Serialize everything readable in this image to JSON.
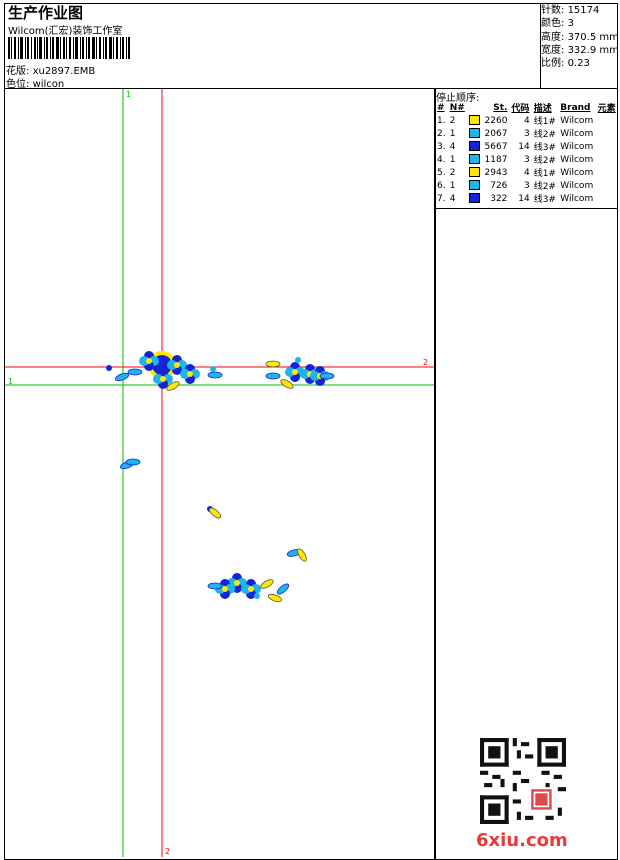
{
  "header": {
    "title": "生产作业图",
    "studio": "Wilcom(汇宏)装饰工作室",
    "pattern_label": "花版:",
    "pattern_value": "xu2897.EMB",
    "color_label": "色位:",
    "color_value": "wilcon"
  },
  "stats": [
    {
      "label": "针数:",
      "value": "15174"
    },
    {
      "label": "颜色:",
      "value": "3"
    },
    {
      "label": "高度:",
      "value": "370.5 mm"
    },
    {
      "label": "宽度:",
      "value": "332.9 mm"
    },
    {
      "label": "比例:",
      "value": "0.23"
    }
  ],
  "stops": {
    "title": "停止顺序:",
    "headers": [
      "#",
      "N#",
      "St.",
      "代码",
      "描述",
      "Brand",
      "元素"
    ],
    "rows": [
      {
        "idx": "1.",
        "n": "2",
        "color": "#ffe800",
        "st": "2260",
        "code": "4",
        "desc": "线1#",
        "brand": "Wilcom"
      },
      {
        "idx": "2.",
        "n": "1",
        "color": "#1eb4ee",
        "st": "2067",
        "code": "3",
        "desc": "线2#",
        "brand": "Wilcom"
      },
      {
        "idx": "3.",
        "n": "4",
        "color": "#1224d6",
        "st": "5667",
        "code": "14",
        "desc": "线3#",
        "brand": "Wilcom"
      },
      {
        "idx": "4.",
        "n": "1",
        "color": "#1eb4ee",
        "st": "1187",
        "code": "3",
        "desc": "线2#",
        "brand": "Wilcom"
      },
      {
        "idx": "5.",
        "n": "2",
        "color": "#ffe800",
        "st": "2943",
        "code": "4",
        "desc": "线1#",
        "brand": "Wilcom"
      },
      {
        "idx": "6.",
        "n": "1",
        "color": "#1eb4ee",
        "st": "726",
        "code": "3",
        "desc": "线2#",
        "brand": "Wilcom"
      },
      {
        "idx": "7.",
        "n": "4",
        "color": "#1224d6",
        "st": "322",
        "code": "14",
        "desc": "线3#",
        "brand": "Wilcom"
      }
    ]
  },
  "canvas": {
    "axis_x_label": "2",
    "axis_y_label": "1",
    "axis_top_label": "1",
    "axis_bottom_label": "2",
    "icons": [
      "flower-motif",
      "qr-code",
      "seal-stamp"
    ]
  },
  "colors": {
    "red_axis": "#ff0000",
    "green_axis": "#00c000",
    "yellow": "#ffe800",
    "cyan": "#1eb4ee",
    "blue": "#1224d6"
  },
  "watermark": "6xiu.com"
}
